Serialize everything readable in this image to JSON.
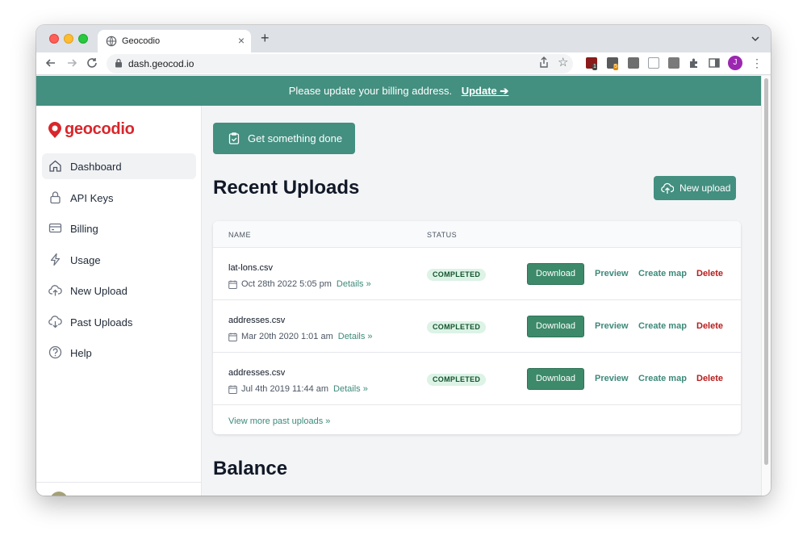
{
  "browser": {
    "tab_title": "Geocodio",
    "tab_close": "×",
    "new_tab": "+",
    "url": "dash.geocod.io",
    "profile_initial": "J",
    "ext_badge_1": "1",
    "ext_badge_2": "5"
  },
  "banner": {
    "message": "Please update your billing address.",
    "link": "Update ➔"
  },
  "sidebar": {
    "logo_text": "geocodio",
    "items": [
      {
        "label": "Dashboard",
        "icon": "home-icon",
        "active": true
      },
      {
        "label": "API Keys",
        "icon": "lock-icon"
      },
      {
        "label": "Billing",
        "icon": "credit-card-icon"
      },
      {
        "label": "Usage",
        "icon": "lightning-icon"
      },
      {
        "label": "New Upload",
        "icon": "cloud-upload-icon"
      },
      {
        "label": "Past Uploads",
        "icon": "cloud-download-icon"
      },
      {
        "label": "Help",
        "icon": "help-circle-icon"
      }
    ]
  },
  "main": {
    "get_something_done": "Get something done",
    "recent_uploads_title": "Recent Uploads",
    "new_upload_button": "New upload",
    "table": {
      "columns": [
        "NAME",
        "STATUS"
      ],
      "rows": [
        {
          "name": "lat-lons.csv",
          "date": "Oct 28th 2022 5:05 pm",
          "details": "Details »",
          "status": "COMPLETED"
        },
        {
          "name": "addresses.csv",
          "date": "Mar 20th 2020 1:01 am",
          "details": "Details »",
          "status": "COMPLETED"
        },
        {
          "name": "addresses.csv",
          "date": "Jul 4th 2019 11:44 am",
          "details": "Details »",
          "status": "COMPLETED"
        }
      ],
      "actions": {
        "download": "Download",
        "preview": "Preview",
        "create_map": "Create map",
        "delete": "Delete"
      },
      "view_more": "View more past uploads »"
    },
    "balance_title": "Balance"
  },
  "colors": {
    "brand_green": "#438f80",
    "brand_red": "#d8262c",
    "badge_bg": "#dcf3e6",
    "delete_red": "#b91c1c"
  }
}
